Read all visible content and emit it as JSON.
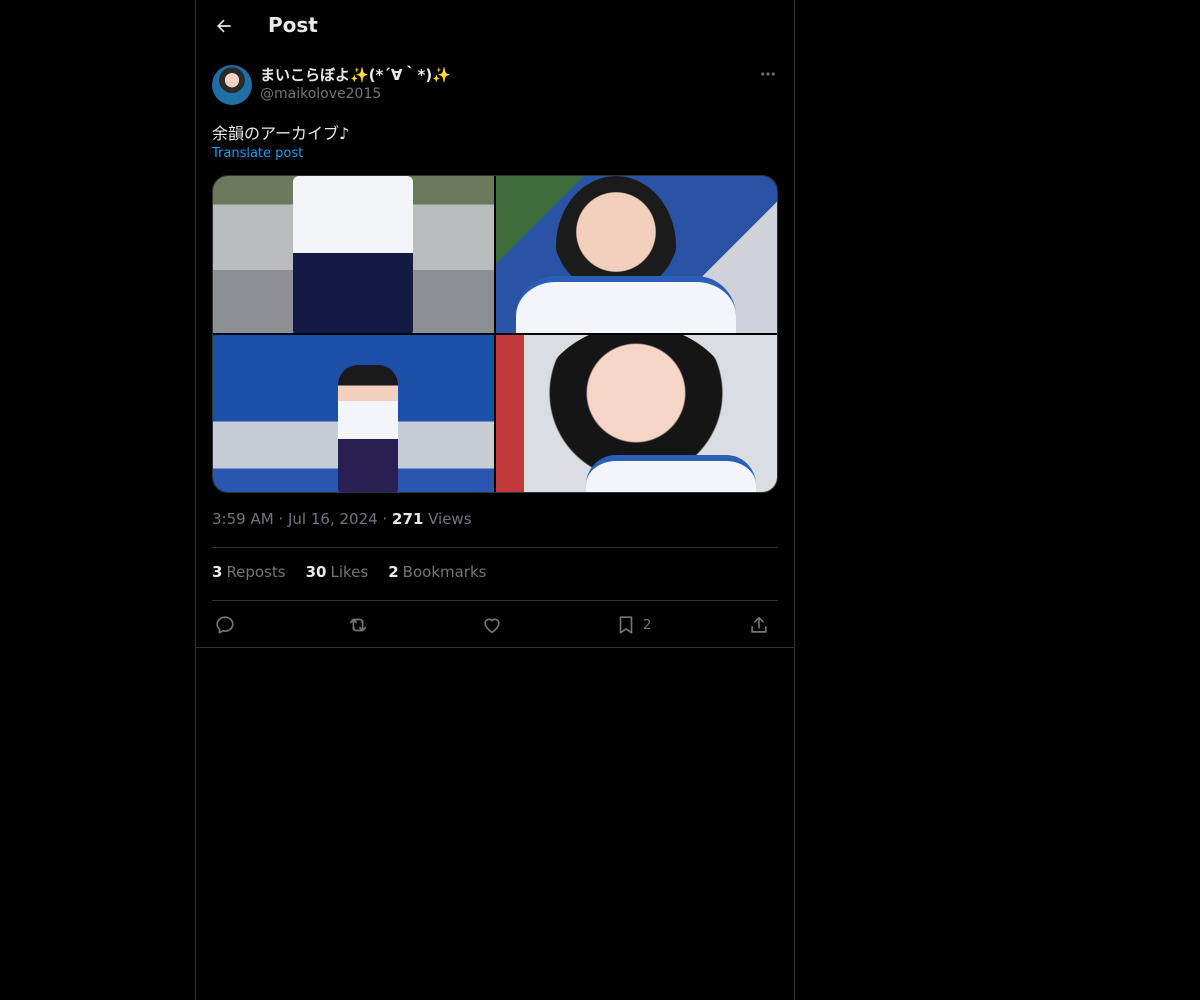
{
  "header": {
    "title": "Post",
    "back_icon": "arrow-left-icon"
  },
  "author": {
    "name": "まいこらぼよ✨(*´∀｀*)✨",
    "handle": "@maikolove2015",
    "avatar_icon": "user-avatar"
  },
  "post": {
    "text": "余韻のアーカイブ♪",
    "translate_label": "Translate post",
    "time": "3:59 AM",
    "separator": "·",
    "date": "Jul 16, 2024",
    "views_count": "271",
    "views_label": "Views"
  },
  "stats": {
    "reposts_count": "3",
    "reposts_label": "Reposts",
    "likes_count": "30",
    "likes_label": "Likes",
    "bookmarks_count": "2",
    "bookmarks_label": "Bookmarks"
  },
  "actions": {
    "reply_icon": "reply-icon",
    "repost_icon": "repost-icon",
    "like_icon": "heart-icon",
    "bookmark_icon": "bookmark-icon",
    "bookmark_count": "2",
    "share_icon": "share-icon"
  },
  "colors": {
    "background": "#000000",
    "text": "#e7e9ea",
    "muted": "#71767b",
    "accent": "#1d9bf0",
    "border": "#2f3336"
  }
}
